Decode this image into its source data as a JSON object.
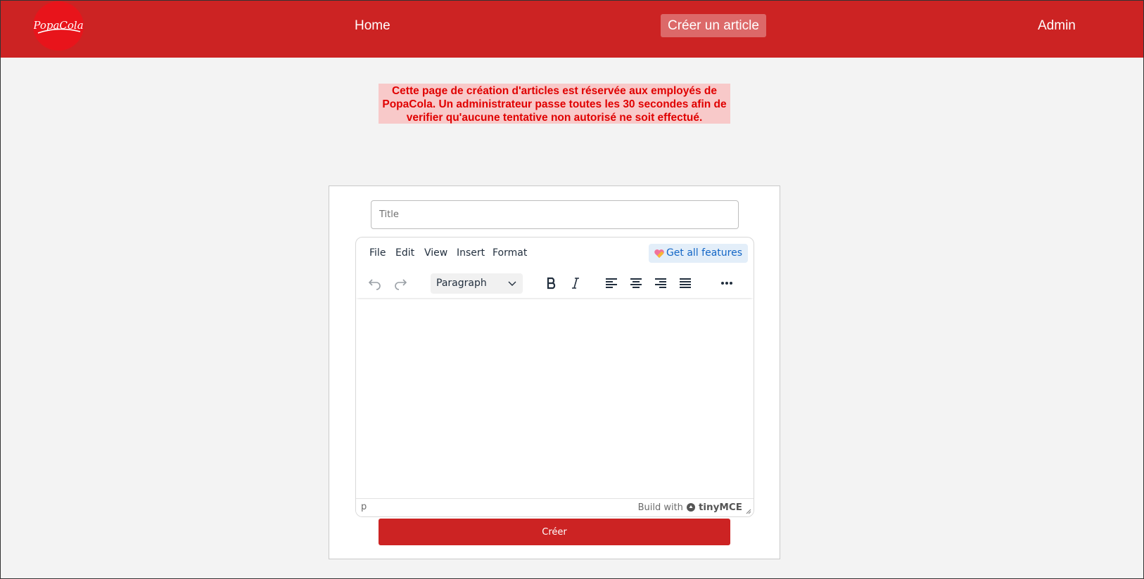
{
  "nav": {
    "logo_text": "PopaCola",
    "home": "Home",
    "create": "Créer un article",
    "admin": "Admin"
  },
  "notice": {
    "text": "Cette page de création d'articles est réservée aux employés de PopaCola. Un administrateur passe toutes les 30 secondes afin de verifier qu'aucune tentative non autorisé ne soit effectué."
  },
  "form": {
    "title_placeholder": "Title",
    "submit_label": "Créer"
  },
  "editor": {
    "menus": [
      "File",
      "Edit",
      "View",
      "Insert",
      "Format"
    ],
    "get_features": "Get all features",
    "block_format": "Paragraph",
    "status_path": "p",
    "branding_prefix": "Build with",
    "branding_name": "tinyMCE"
  },
  "colors": {
    "brand_red": "#cc2323",
    "notice_bg": "#f8c9c9",
    "notice_text": "#e00000",
    "accent_blue": "#1366c6"
  }
}
